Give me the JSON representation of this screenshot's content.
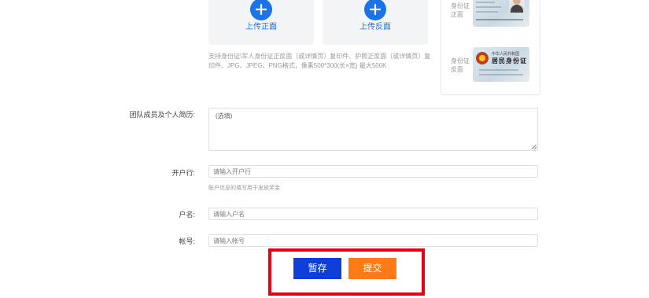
{
  "upload": {
    "front_label": "上传正面",
    "back_label": "上传反面",
    "hint": "支持身份证\\军人身份证正反面（或详情页）复印件、护照正反面（或详情页）复印件、JPG、JPEG、PNG格式，像素500*300(长×宽) 最大500K"
  },
  "id_example": {
    "front_side_label": "身份证正面",
    "back_side_label": "身份证反面",
    "back_card_title": "中华人民共和国",
    "back_card_main": "居民身份证"
  },
  "form": {
    "resume": {
      "label": "团队成员及个人简历:",
      "placeholder": "(选填)"
    },
    "bank": {
      "label": "开户行:",
      "placeholder": "请输入开户行",
      "hint": "账户信息的填写用于发放奖金"
    },
    "account_name": {
      "label": "户名:",
      "placeholder": "请输入户名"
    },
    "account_number": {
      "label": "帐号:",
      "placeholder": "请输入帐号"
    }
  },
  "actions": {
    "save_label": "暂存",
    "submit_label": "提交"
  },
  "colors": {
    "accent_blue": "#1a74e8",
    "save_button": "#0d3fd8",
    "submit_button": "#ff7a14",
    "highlight_border": "#e60012"
  }
}
